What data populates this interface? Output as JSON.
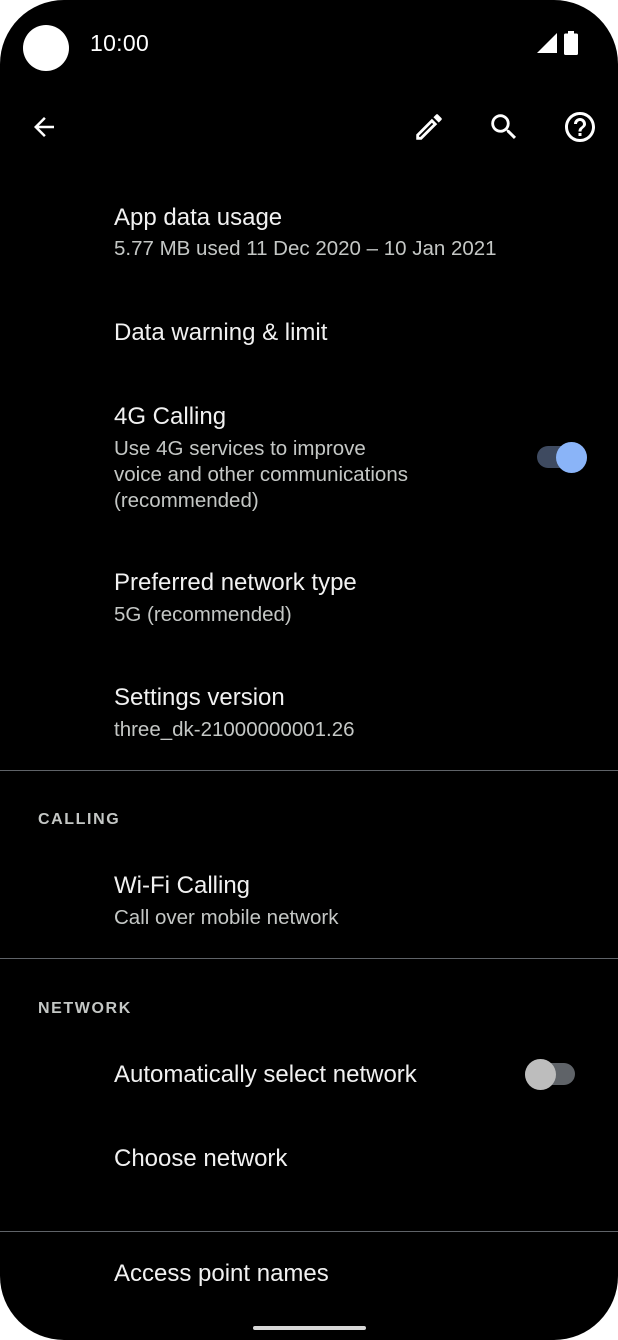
{
  "status_bar": {
    "time": "10:00"
  },
  "app_bar": {
    "back_icon": "arrow-left-icon",
    "edit_icon": "pencil-icon",
    "search_icon": "search-icon",
    "help_icon": "help-circle-icon"
  },
  "settings": {
    "app_data_usage": {
      "title": "App data usage",
      "subtitle": "5.77 MB used 11 Dec 2020 – 10 Jan 2021"
    },
    "data_warning": {
      "title": "Data warning & limit"
    },
    "four_g_calling": {
      "title": "4G Calling",
      "subtitle_lines": [
        "Use 4G services to improve",
        "voice and other communications",
        "(recommended)"
      ],
      "enabled": true
    },
    "preferred_network": {
      "title": "Preferred network type",
      "subtitle": "5G (recommended)"
    },
    "settings_version": {
      "title": "Settings version",
      "subtitle": "three_dk-21000000001.26"
    }
  },
  "calling_section": {
    "header": "CALLING",
    "wifi_calling": {
      "title": "Wi-Fi Calling",
      "subtitle": "Call over mobile network"
    }
  },
  "network_section": {
    "header": "NETWORK",
    "auto_select": {
      "title": "Automatically select network",
      "enabled": false
    },
    "choose_network": {
      "title": "Choose network"
    },
    "apn": {
      "title": "Access point names"
    }
  },
  "colors": {
    "accent_thumb": "#8ab4f8",
    "accent_track": "#3e4a60",
    "off_thumb": "#bdbdbd",
    "off_track": "#5f6368"
  }
}
